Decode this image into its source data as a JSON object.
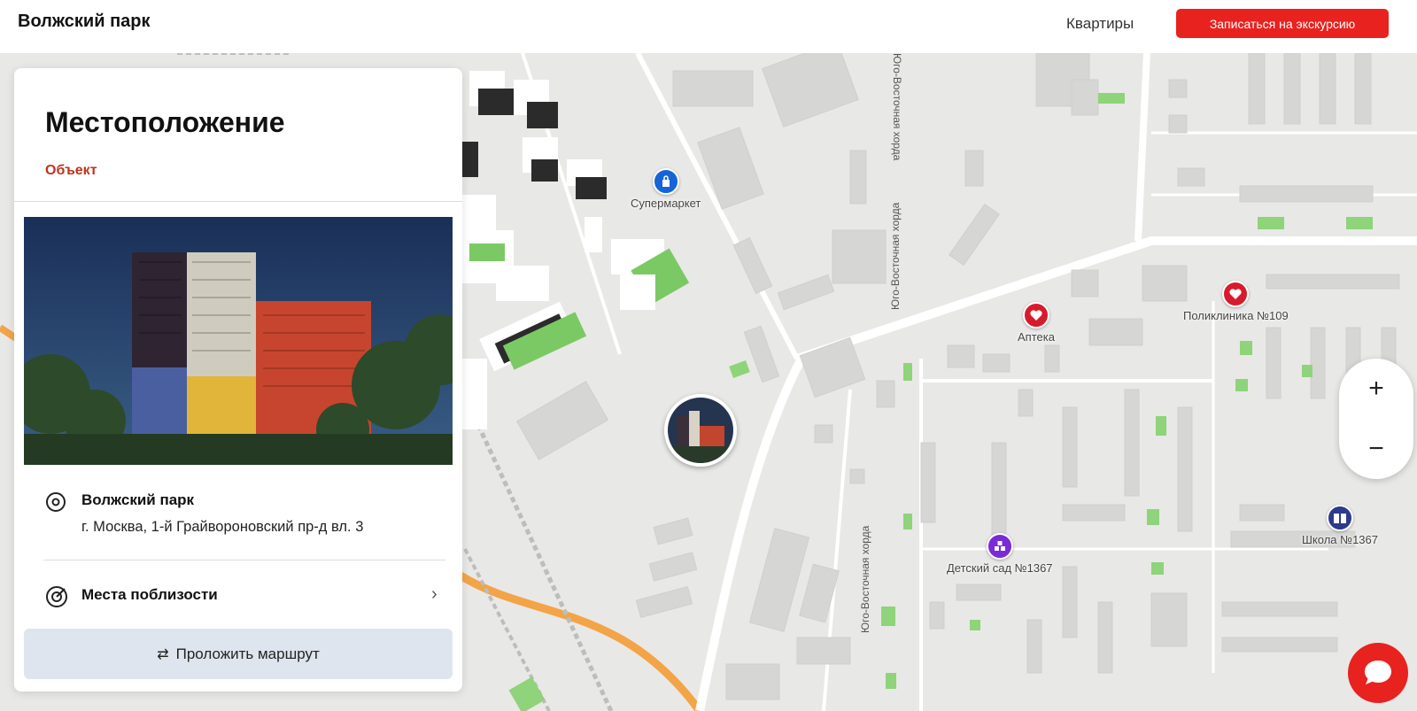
{
  "header": {
    "brand": "Волжский парк",
    "nav_apartments": "Квартиры",
    "cta_label": "Записаться на экскурсию"
  },
  "card": {
    "title": "Местоположение",
    "tab_object": "Объект",
    "address_name": "Волжский парк",
    "address_line": "г. Москва, 1-й Грайвороновский пр-д вл. 3",
    "nearby_label": "Места поблизости",
    "route_label": "Проложить маршрут"
  },
  "map": {
    "road_labels": [
      "Юго-Восточная хорда",
      "Юго-Восточная хорда",
      "Юго-Восточная хорда"
    ],
    "pois": {
      "supermarket": {
        "label": "Супермаркет",
        "icon": "shopping-bag-icon",
        "color": "#1565d8"
      },
      "pharmacy": {
        "label": "Аптека",
        "icon": "heart-plus-icon",
        "color": "#d81b2c"
      },
      "polyclinic": {
        "label": "Поликлиника №109",
        "icon": "heart-plus-icon",
        "color": "#d81b2c"
      },
      "kindergarten": {
        "label": "Детский сад №1367",
        "icon": "blocks-icon",
        "color": "#7b2ad8"
      },
      "school": {
        "label": "Школа №1367",
        "icon": "book-icon",
        "color": "#2b3a8c"
      }
    },
    "zoom_in": "+",
    "zoom_out": "−"
  },
  "colors": {
    "accent": "#e8221f",
    "tab_accent": "#c0331e",
    "route_button_bg": "#dfe5ee",
    "map_bg": "#e8e8e6"
  }
}
